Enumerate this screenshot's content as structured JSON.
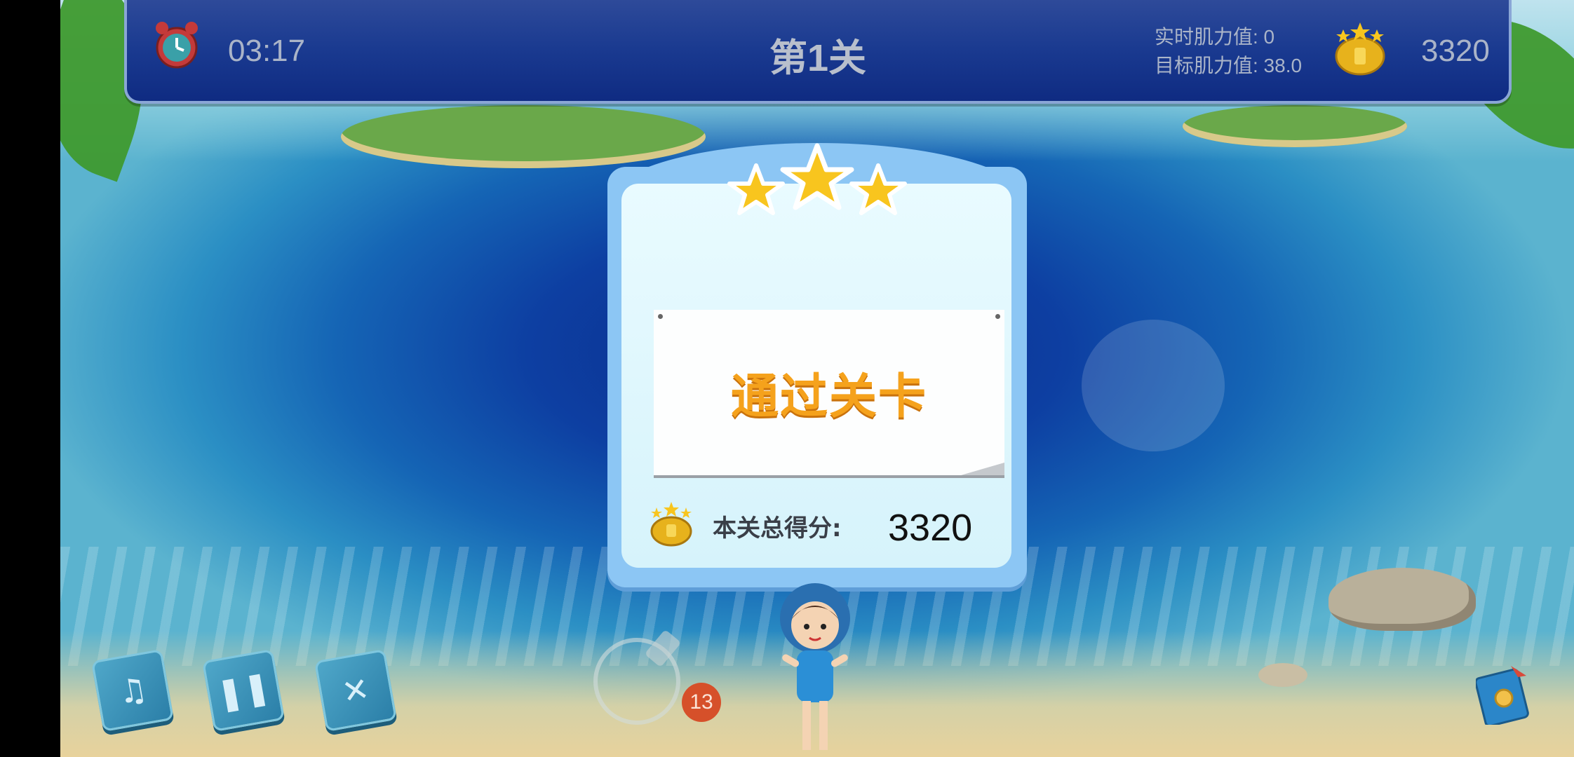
{
  "topbar": {
    "timer": "03:17",
    "level_title": "第1关",
    "realtime_muscle": "实时肌力值: 0",
    "target_muscle": "目标肌力值: 38.0",
    "score": "3320",
    "icons": [
      "alarm-clock-icon",
      "gold-coin-stars-icon"
    ]
  },
  "result_dialog": {
    "stars_earned": 3,
    "stars_total": 3,
    "title": "通过关卡",
    "total_score_label": "本关总得分:",
    "total_score_value": "3320"
  },
  "controls": {
    "buttons": [
      "music-note-icon",
      "pause-icon",
      "close-icon"
    ],
    "item_count": "13"
  },
  "colors": {
    "topbar": "#1a3a90",
    "dialog_border": "#8cc6f4",
    "star": "#f8c51e",
    "pass_text": "#f5a21c",
    "badge": "#d6502a"
  }
}
